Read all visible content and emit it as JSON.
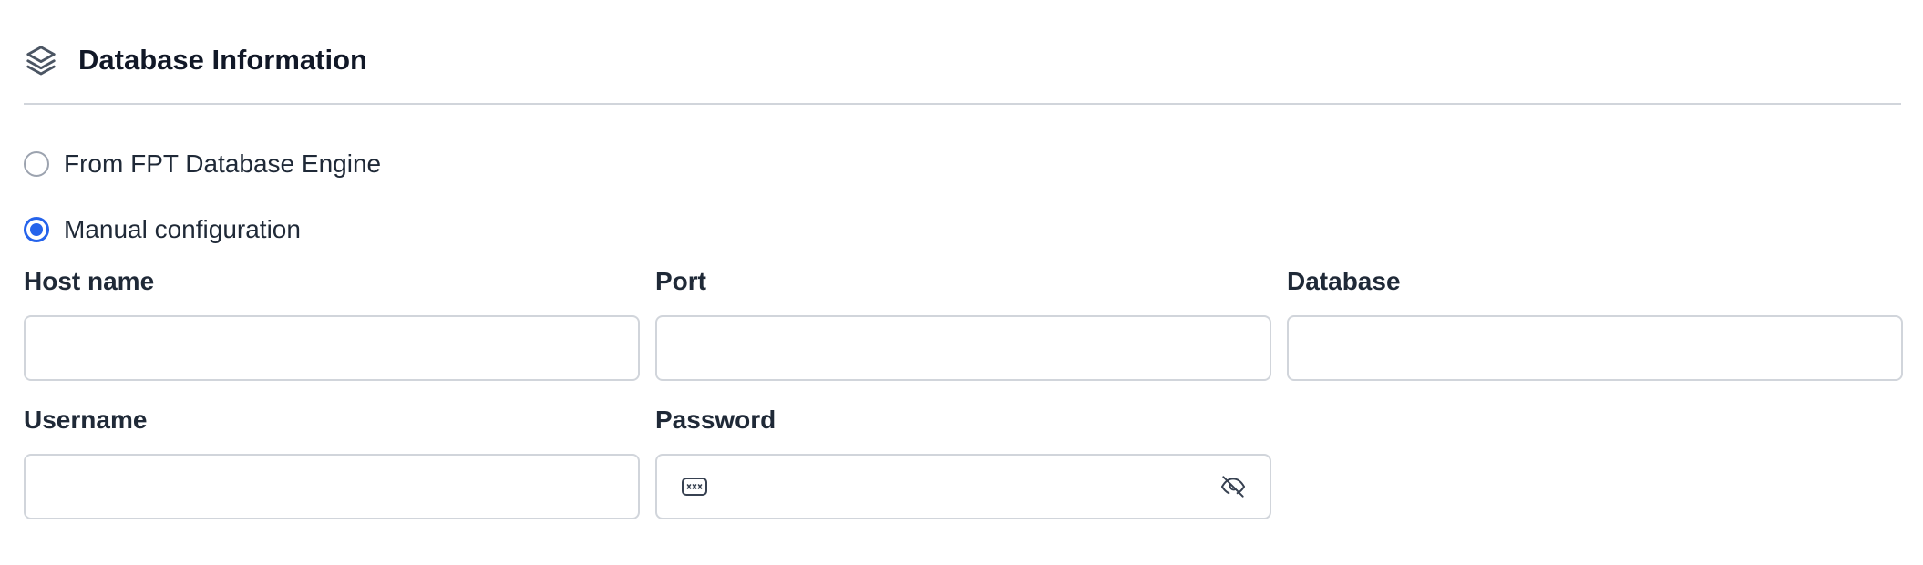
{
  "header": {
    "icon": "layers-icon",
    "title": "Database Information"
  },
  "source_options": [
    {
      "label": "From FPT Database Engine",
      "selected": false
    },
    {
      "label": "Manual configuration",
      "selected": true
    }
  ],
  "fields": {
    "host_name": {
      "label": "Host name",
      "value": "",
      "placeholder": ""
    },
    "port": {
      "label": "Port",
      "value": "",
      "placeholder": ""
    },
    "database": {
      "label": "Database",
      "value": "",
      "placeholder": ""
    },
    "username": {
      "label": "Username",
      "value": "",
      "placeholder": ""
    },
    "password": {
      "label": "Password",
      "value": "",
      "placeholder": "",
      "left_icon": "password-dots-icon",
      "toggle_icon": "eye-off-icon"
    }
  },
  "colors": {
    "accent": "#2563eb",
    "border": "#d1d5db",
    "text": "#111827"
  }
}
